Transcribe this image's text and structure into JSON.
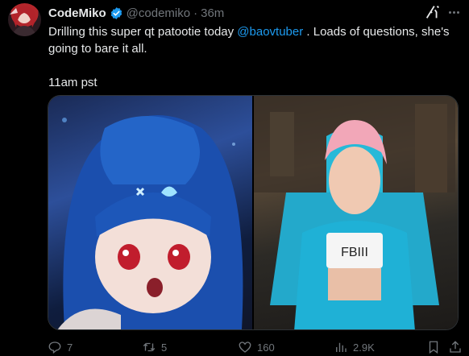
{
  "author": {
    "display_name": "CodeMiko",
    "handle": "@codemiko",
    "separator": "·",
    "time_ago": "36m"
  },
  "tweet": {
    "text_before": "Drilling this super qt patootie today ",
    "mention": "@baovtuber",
    "text_after": " . Loads of questions, she's going to bare it all.",
    "time_line": "11am pst"
  },
  "media": [
    {
      "icon": "anime-vtuber-portrait"
    },
    {
      "icon": "3d-avatar-gaming-chair"
    }
  ],
  "actions": {
    "reply_count": "7",
    "retweet_count": "5",
    "like_count": "160",
    "view_count": "2.9K"
  },
  "colors": {
    "background": "#000000",
    "text": "#e7e9ea",
    "muted": "#71767b",
    "link": "#1d9bf0",
    "border": "#2f3336"
  }
}
